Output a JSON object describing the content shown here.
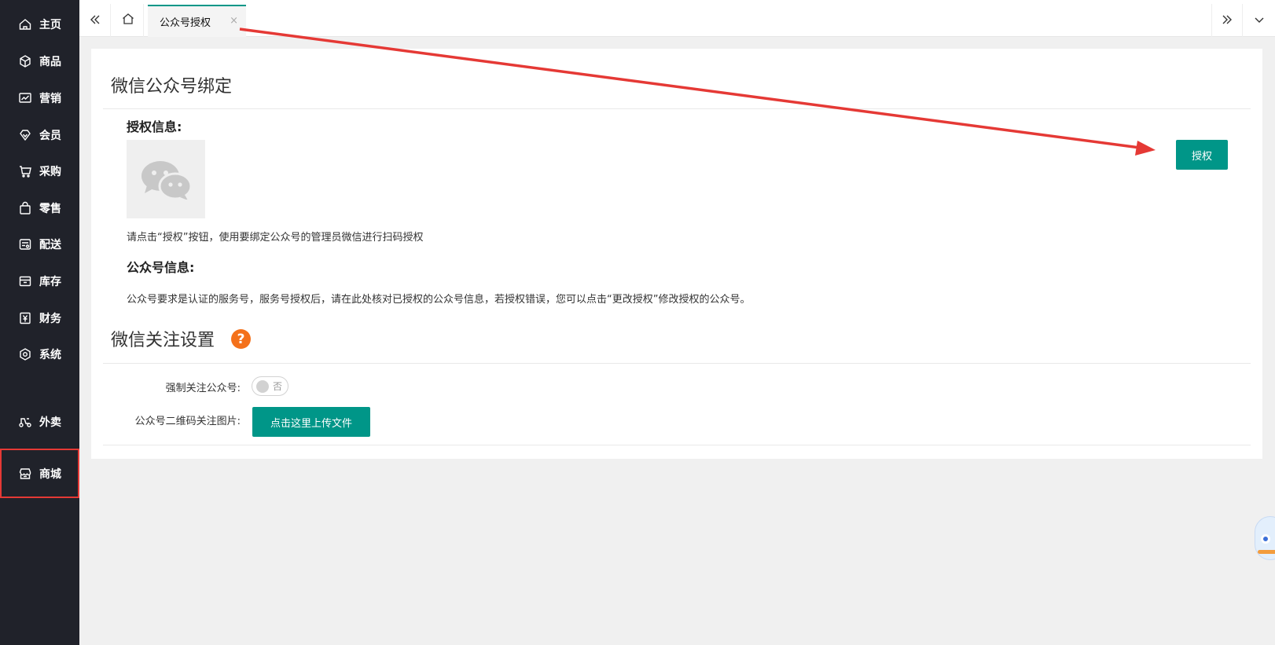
{
  "sidebar": {
    "items": [
      {
        "label": "主页",
        "icon": "home-icon"
      },
      {
        "label": "商品",
        "icon": "cube-icon"
      },
      {
        "label": "营销",
        "icon": "trend-chart-icon"
      },
      {
        "label": "会员",
        "icon": "diamond-icon"
      },
      {
        "label": "采购",
        "icon": "cart-icon"
      },
      {
        "label": "零售",
        "icon": "shopping-bag-icon"
      },
      {
        "label": "配送",
        "icon": "delivery-icon"
      },
      {
        "label": "库存",
        "icon": "inventory-box-icon"
      },
      {
        "label": "财务",
        "icon": "yen-icon"
      },
      {
        "label": "系统",
        "icon": "gear-icon"
      },
      {
        "label": "外卖",
        "icon": "scooter-icon"
      },
      {
        "label": "商城",
        "icon": "store-icon"
      }
    ],
    "highlight_color": "#e53935"
  },
  "topbar": {
    "active_tab": "公众号授权",
    "close_glyph": "×"
  },
  "main": {
    "binding": {
      "title": "微信公众号绑定",
      "auth_info_label": "授权信息:",
      "auth_hint": "请点击“授权”按钮，使用要绑定公众号的管理员微信进行扫码授权",
      "account_info_label": "公众号信息:",
      "account_note": "公众号要求是认证的服务号，服务号授权后，请在此处核对已授权的公众号信息，若授权错误，您可以点击“更改授权”修改授权的公众号。",
      "authorize_button": "授权"
    },
    "follow": {
      "title": "微信关注设置",
      "help_glyph": "?",
      "force_follow_label": "强制关注公众号:",
      "force_follow_value": "否",
      "qrcode_label": "公众号二维码关注图片:",
      "upload_button": "点击这里上传文件"
    }
  },
  "colors": {
    "accent": "#009688",
    "sidebar_bg": "#20222a",
    "help": "#f4711b",
    "annotation_arrow": "#e53935"
  }
}
